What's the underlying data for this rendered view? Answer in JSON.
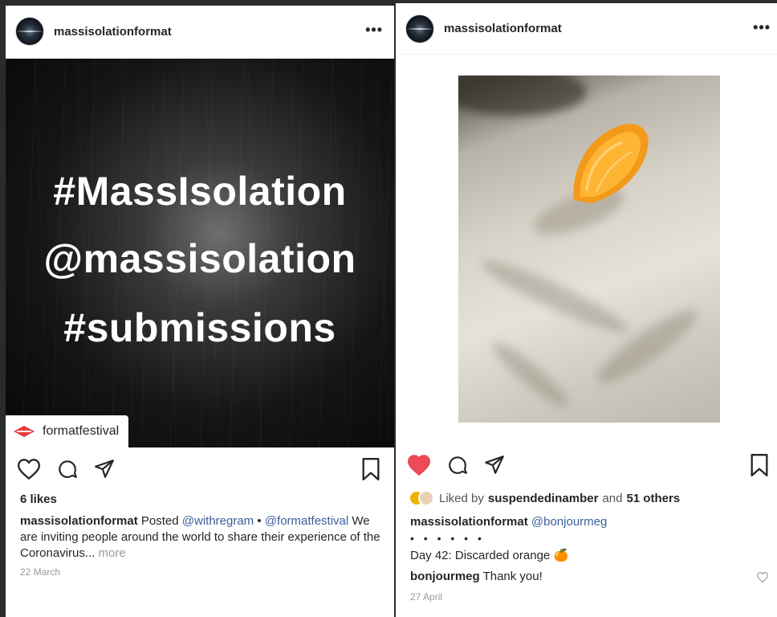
{
  "left_post": {
    "username": "massisolationformat",
    "more": "•••",
    "image_lines": [
      "#MassIsolation",
      "@massisolation",
      "#submissions"
    ],
    "tag": "formatfestival",
    "likes": "6 likes",
    "caption": {
      "username": "massisolationformat",
      "posted": "Posted",
      "mention1": "@withregram",
      "bullet": "•",
      "mention2": "@formatfestival",
      "text": "We are inviting people around the world to share their experience of the Coronavirus...",
      "more": "more"
    },
    "date": "22 March"
  },
  "right_post": {
    "username": "massisolationformat",
    "more": "•••",
    "liked_prefix": "Liked by",
    "liked_user": "suspendedinamber",
    "liked_and": "and",
    "liked_others": "51 others",
    "caption_username": "massisolationformat",
    "caption_mention": "@bonjourmeg",
    "bullets": "• • • • • •",
    "caption_text": "Day 42: Discarded orange",
    "caption_emoji": "🍊",
    "comment_username": "bonjourmeg",
    "comment_text": "Thank you!",
    "date": "27 April"
  },
  "colors": {
    "heart_red": "#ed4956",
    "mention_blue": "#3a5f9a",
    "background": "#2b2b2b"
  }
}
